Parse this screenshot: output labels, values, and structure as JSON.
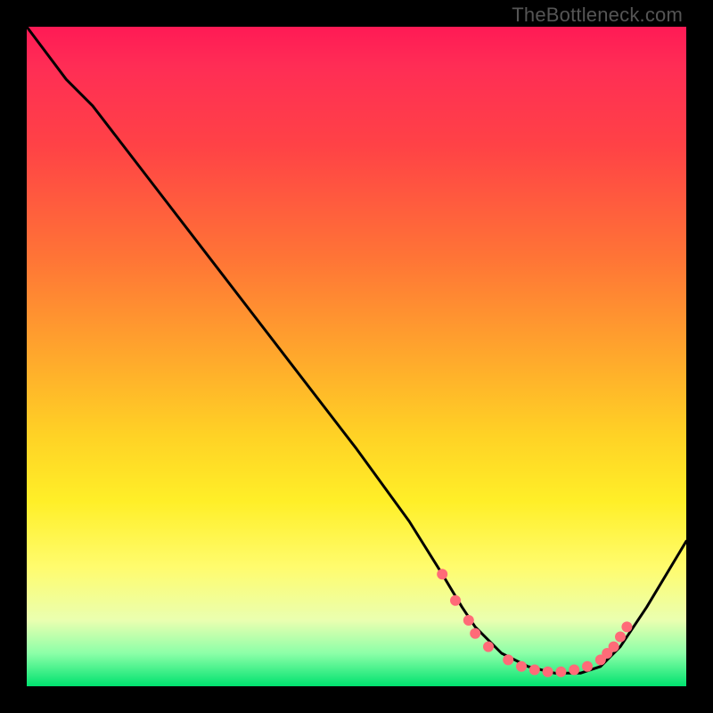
{
  "watermark": "TheBottleneck.com",
  "chart_data": {
    "type": "line",
    "title": "",
    "xlabel": "",
    "ylabel": "",
    "xlim": [
      0,
      100
    ],
    "ylim": [
      0,
      100
    ],
    "grid": false,
    "legend": false,
    "series": [
      {
        "name": "curve",
        "x": [
          0,
          6,
          10,
          20,
          30,
          40,
          50,
          58,
          63,
          66,
          68,
          72,
          76,
          80,
          84,
          87,
          90,
          94,
          100
        ],
        "y": [
          100,
          92,
          88,
          75,
          62,
          49,
          36,
          25,
          17,
          12,
          9,
          5,
          3,
          2,
          2,
          3,
          6,
          12,
          22
        ]
      }
    ],
    "markers": [
      {
        "x": 63,
        "y": 17
      },
      {
        "x": 65,
        "y": 13
      },
      {
        "x": 67,
        "y": 10
      },
      {
        "x": 68,
        "y": 8
      },
      {
        "x": 70,
        "y": 6
      },
      {
        "x": 73,
        "y": 4
      },
      {
        "x": 75,
        "y": 3
      },
      {
        "x": 77,
        "y": 2.5
      },
      {
        "x": 79,
        "y": 2.2
      },
      {
        "x": 81,
        "y": 2.2
      },
      {
        "x": 83,
        "y": 2.5
      },
      {
        "x": 85,
        "y": 3
      },
      {
        "x": 87,
        "y": 4
      },
      {
        "x": 88,
        "y": 5
      },
      {
        "x": 89,
        "y": 6
      },
      {
        "x": 90,
        "y": 7.5
      },
      {
        "x": 91,
        "y": 9
      }
    ],
    "colors": {
      "curve": "#000000",
      "markers": "#ff6b78"
    }
  }
}
